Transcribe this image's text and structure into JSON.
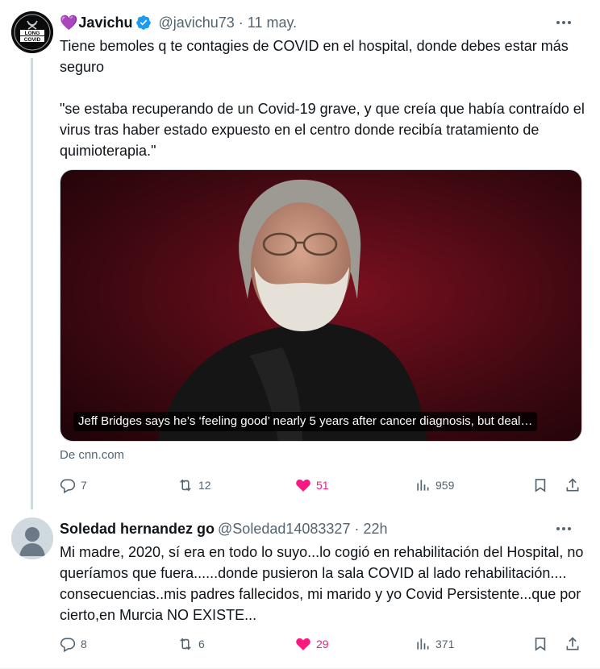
{
  "tweet1": {
    "display_name": "Javichu",
    "name_emoji": "💜",
    "avatar_text": {
      "top": "LONG",
      "bottom": "COVID"
    },
    "handle": "@javichu73",
    "separator": "·",
    "time": "11 may.",
    "text_line1": "Tiene bemoles q te contagies de COVID en el hospital, donde debes estar más seguro",
    "text_line2": "\"se estaba recuperando de un Covid-19 grave, y que creía que había contraído el virus tras haber estado expuesto en el centro donde recibía tratamiento de quimioterapia.\"",
    "card": {
      "caption": "Jeff Bridges says he’s ‘feeling good’ nearly 5 years after cancer diagnosis, but deal…",
      "source": "De cnn.com"
    },
    "stats": {
      "replies": "7",
      "retweets": "12",
      "likes": "51",
      "views": "959"
    }
  },
  "tweet2": {
    "display_name": "Soledad hernandez go",
    "handle": "@Soledad14083327",
    "separator": "·",
    "time": "22h",
    "text": "Mi madre, 2020, sí era en todo lo suyo...lo cogió en rehabilitación del Hospital, no queríamos que fuera......donde pusieron la sala COVID al lado rehabilitación.... consecuencias..mis padres fallecidos, mi marido y yo Covid Persistente...que por cierto,en Murcia NO EXISTE...",
    "stats": {
      "replies": "8",
      "retweets": "6",
      "likes": "29",
      "views": "371"
    }
  },
  "colors": {
    "text": "#0f1419",
    "secondary": "#536471",
    "like": "#f91880",
    "verified": "#1d9bf0",
    "thread_line": "#cfd9de"
  },
  "icons": [
    "verified-badge-icon",
    "more-icon",
    "reply-icon",
    "retweet-icon",
    "heart-icon",
    "views-icon",
    "bookmark-icon",
    "share-icon",
    "default-avatar-icon"
  ]
}
